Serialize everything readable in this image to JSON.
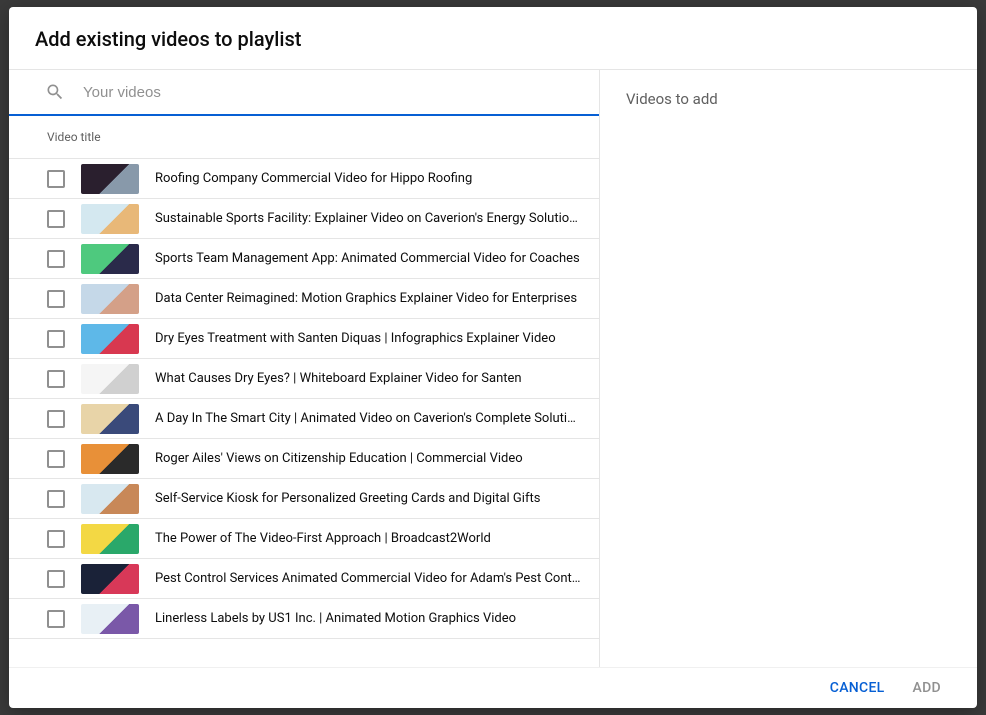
{
  "dialog": {
    "title": "Add existing videos to playlist"
  },
  "search": {
    "placeholder": "Your videos"
  },
  "column_header": "Video title",
  "right_panel": {
    "title": "Videos to add"
  },
  "footer": {
    "cancel_label": "CANCEL",
    "add_label": "ADD"
  },
  "videos": [
    {
      "title": "Roofing Company Commercial Video for Hippo Roofing",
      "thumb_bg": "#2a1f2e",
      "thumb_accent": "#8899aa"
    },
    {
      "title": "Sustainable Sports Facility: Explainer Video on Caverion's Energy Solutions",
      "thumb_bg": "#d4e8f0",
      "thumb_accent": "#e8b878"
    },
    {
      "title": "Sports Team Management App: Animated Commercial Video for Coaches",
      "thumb_bg": "#4ec97e",
      "thumb_accent": "#2a2a4a"
    },
    {
      "title": "Data Center Reimagined: Motion Graphics Explainer Video for Enterprises",
      "thumb_bg": "#c5d8e8",
      "thumb_accent": "#d4a088"
    },
    {
      "title": "Dry Eyes Treatment with Santen Diquas | Infographics Explainer Video",
      "thumb_bg": "#5eb8e8",
      "thumb_accent": "#d83850"
    },
    {
      "title": "What Causes Dry Eyes? | Whiteboard Explainer Video for Santen",
      "thumb_bg": "#f5f5f5",
      "thumb_accent": "#d0d0d0"
    },
    {
      "title": "A Day In The Smart City | Animated Video on Caverion's Complete Solutions",
      "thumb_bg": "#e8d4a8",
      "thumb_accent": "#3a4a7a"
    },
    {
      "title": "Roger Ailes' Views on Citizenship Education | Commercial Video",
      "thumb_bg": "#e89038",
      "thumb_accent": "#2a2a2a"
    },
    {
      "title": "Self-Service Kiosk for Personalized Greeting Cards and Digital Gifts",
      "thumb_bg": "#d8e8f0",
      "thumb_accent": "#c88858"
    },
    {
      "title": "The Power of The Video-First Approach | Broadcast2World",
      "thumb_bg": "#f3d844",
      "thumb_accent": "#2aa86a"
    },
    {
      "title": "Pest Control Services Animated Commercial Video for Adam's Pest Control",
      "thumb_bg": "#1a2238",
      "thumb_accent": "#d83858"
    },
    {
      "title": "Linerless Labels by US1 Inc. | Animated Motion Graphics Video",
      "thumb_bg": "#e8f0f5",
      "thumb_accent": "#7a58a8"
    }
  ]
}
